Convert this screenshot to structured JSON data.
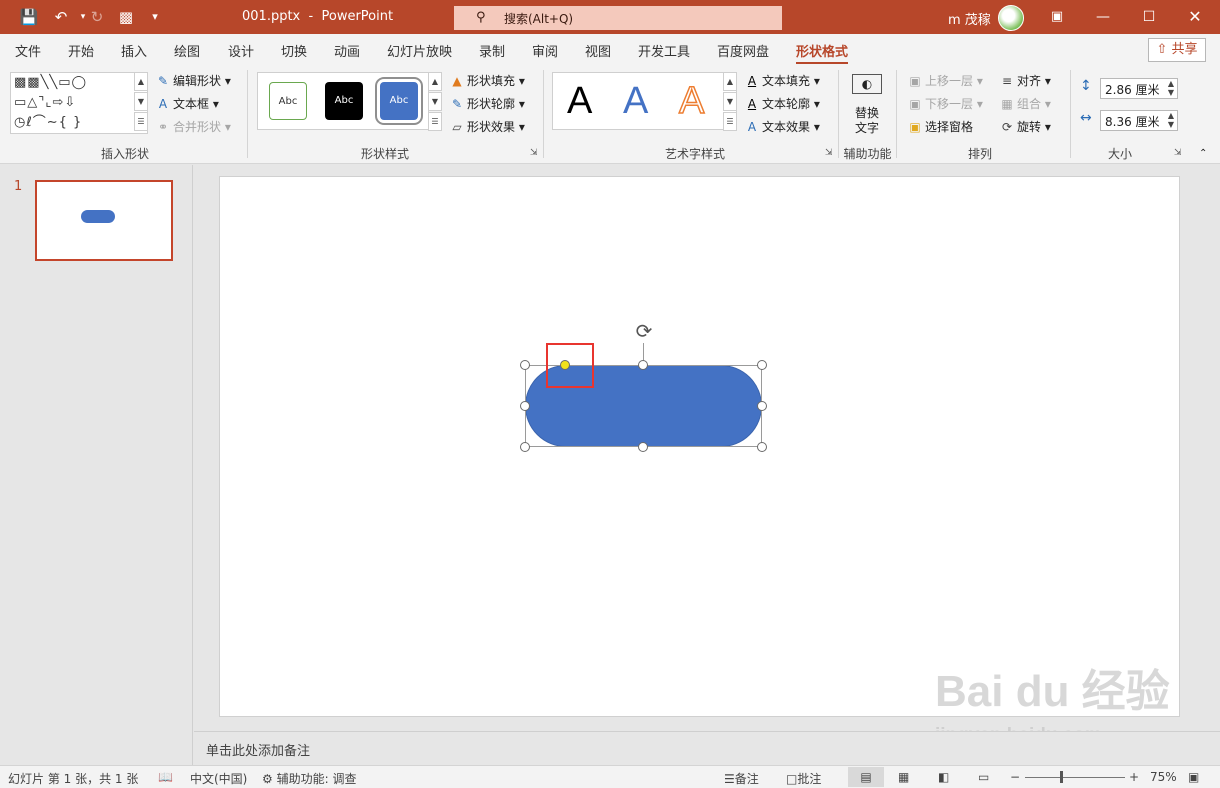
{
  "app": {
    "doc_name": "001.pptx",
    "separator": "  -  ",
    "app_name": "PowerPoint"
  },
  "search": {
    "label": "搜索(Alt+Q)"
  },
  "user": {
    "name": "m 茂稼"
  },
  "tabs": [
    "文件",
    "开始",
    "插入",
    "绘图",
    "设计",
    "切换",
    "动画",
    "幻灯片放映",
    "录制",
    "审阅",
    "视图",
    "开发工具",
    "百度网盘",
    "形状格式"
  ],
  "active_tab": "形状格式",
  "share": "共享",
  "ribbon": {
    "insert_shapes": {
      "edit_shape": "编辑形状",
      "text_box": "文本框",
      "merge_shapes": "合并形状",
      "label": "插入形状"
    },
    "shape_styles": {
      "swatches": [
        "Abc",
        "Abc",
        "Abc"
      ],
      "fill": "形状填充",
      "outline": "形状轮廓",
      "effects": "形状效果",
      "label": "形状样式"
    },
    "wordart": {
      "letters": [
        "A",
        "A",
        "A"
      ],
      "text_fill": "文本填充",
      "text_outline": "文本轮廓",
      "text_effects": "文本效果",
      "label": "艺术字样式"
    },
    "accessibility": {
      "alt_text_1": "替换",
      "alt_text_2": "文字",
      "label": "辅助功能"
    },
    "arrange": {
      "bring_forward": "上移一层",
      "send_backward": "下移一层",
      "selection_pane": "选择窗格",
      "align": "对齐",
      "group": "组合",
      "rotate": "旋转",
      "label": "排列"
    },
    "size": {
      "height": "2.86 厘米",
      "width": "8.36 厘米",
      "label": "大小"
    }
  },
  "slides": {
    "numbers": [
      "1"
    ]
  },
  "notes_placeholder": "单击此处添加备注",
  "status": {
    "slide_info": "幻灯片 第 1 张，共 1 张",
    "language": "中文(中国)",
    "accessibility": "辅助功能: 调查",
    "notes": "备注",
    "comments": "批注",
    "zoom_minus": "−",
    "zoom_plus": "+",
    "zoom": "75%"
  },
  "watermark": {
    "logo": "Bai du 经验",
    "url": "jingyan.baidu.com"
  },
  "colors": {
    "accent": "#b7472a",
    "shape_fill": "#4472c4",
    "adjust_handle": "#f2e21c",
    "highlight": "#e8352f"
  }
}
